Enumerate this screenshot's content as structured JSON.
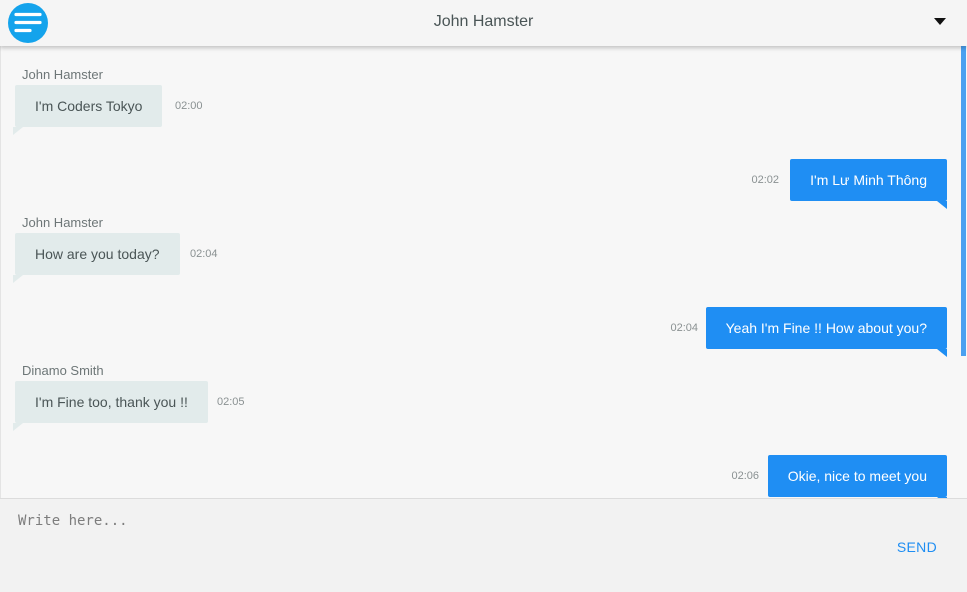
{
  "header": {
    "title": "John Hamster",
    "menu_icon": "menu-icon",
    "dropdown_icon": "caret-down-icon"
  },
  "colors": {
    "accent": "#14a3ec",
    "outgoing_bubble": "#1f8ef3",
    "incoming_bubble": "#e2ebeb"
  },
  "messages": [
    {
      "direction": "in",
      "sender": "John Hamster",
      "text": "I'm Coders Tokyo",
      "time": "02:00"
    },
    {
      "direction": "out",
      "text": "I'm Lư Minh Thông",
      "time": "02:02"
    },
    {
      "direction": "in",
      "sender": "John Hamster",
      "text": "How are you today?",
      "time": "02:04"
    },
    {
      "direction": "out",
      "text": "Yeah I'm Fine !! How about you?",
      "time": "02:04"
    },
    {
      "direction": "in",
      "sender": "Dinamo Smith",
      "text": "I'm Fine too, thank you !!",
      "time": "02:05"
    },
    {
      "direction": "out",
      "text": "Okie, nice to meet you",
      "time": "02:06"
    }
  ],
  "composer": {
    "placeholder": "Write here...",
    "send_label": "SEND"
  }
}
